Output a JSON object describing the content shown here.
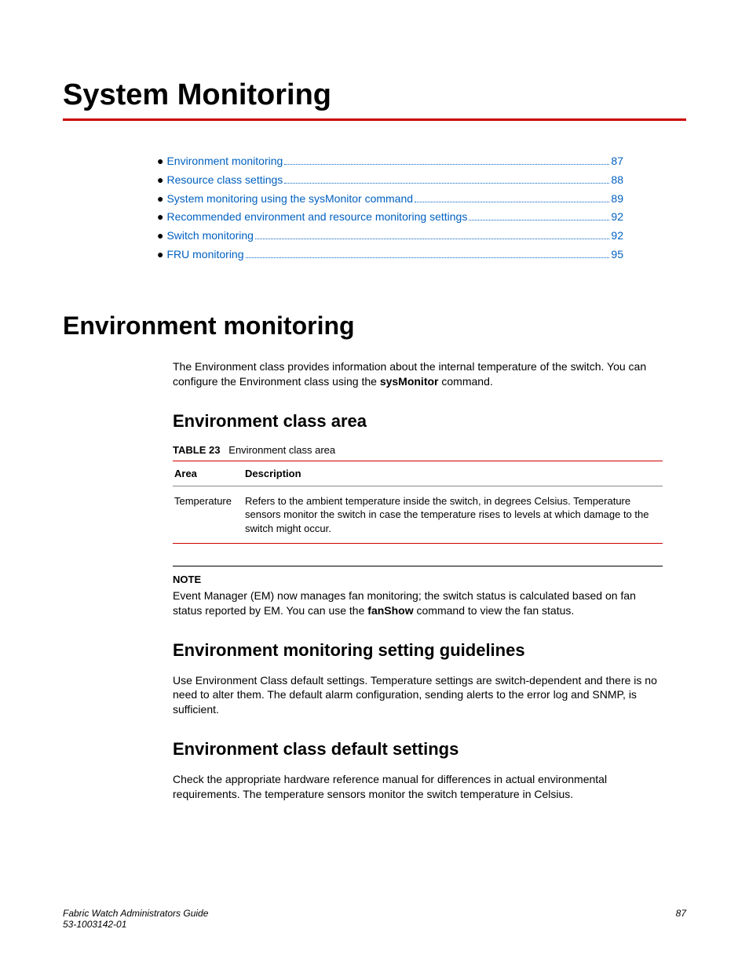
{
  "page": {
    "title": "System Monitoring",
    "section_title": "Environment monitoring",
    "intro_pre": "The Environment class provides information about the internal temperature of the switch. You can configure the Environment class using the ",
    "intro_bold": "sysMonitor",
    "intro_post": " command.",
    "h3_area": "Environment class area",
    "table_caption_label": "TABLE 23",
    "table_caption_text": "Environment class area",
    "th_area": "Area",
    "th_desc": "Description",
    "td_area": "Temperature",
    "td_desc": "Refers to the ambient temperature inside the switch, in degrees Celsius. Temperature sensors monitor the switch in case the temperature rises to levels at which damage to the switch might occur.",
    "note_label": "NOTE",
    "note_pre": "Event Manager (EM) now manages fan monitoring; the switch status is calculated based on fan status reported by EM. You can use the ",
    "note_bold": "fanShow",
    "note_post": " command to view the fan status.",
    "h3_guidelines": "Environment monitoring setting guidelines",
    "guidelines_text": "Use Environment Class default settings. Temperature settings are switch-dependent and there is no need to alter them. The default alarm configuration, sending alerts to the error log and SNMP, is sufficient.",
    "h3_defaults": "Environment class default settings",
    "defaults_text": "Check the appropriate hardware reference manual for differences in actual environmental requirements. The temperature sensors monitor the switch temperature in Celsius."
  },
  "toc": [
    {
      "label": "Environment monitoring",
      "page": "87"
    },
    {
      "label": "Resource class settings",
      "page": "88"
    },
    {
      "label": "System monitoring using the sysMonitor command",
      "page": "89"
    },
    {
      "label": "Recommended environment and resource monitoring settings",
      "page": "92"
    },
    {
      "label": "Switch monitoring",
      "page": "92"
    },
    {
      "label": "FRU monitoring",
      "page": "95"
    }
  ],
  "footer": {
    "book": "Fabric Watch Administrators Guide",
    "docnum": "53-1003142-01",
    "page": "87"
  }
}
